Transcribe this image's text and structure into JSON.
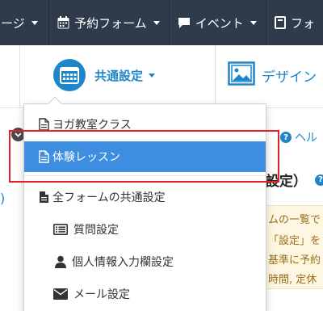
{
  "topnav": {
    "tab1_label": "ページ",
    "tab2_label": "予約フォーム",
    "tab3_label": "イベント",
    "tab4_label": "フォ"
  },
  "subnav": {
    "common_settings_label": "共通設定",
    "design_label": "デザイン"
  },
  "dropdown": {
    "items": [
      {
        "label": "ヨガ教室クラス",
        "icon": "document-icon"
      },
      {
        "label": "体験レッスン",
        "icon": "document-icon",
        "selected": true
      },
      {
        "label": "全フォームの共通設定",
        "icon": "document-filled-icon"
      },
      {
        "label": "質問設定",
        "icon": "list-icon"
      },
      {
        "label": "個人情報入力欄設定",
        "icon": "user-icon"
      },
      {
        "label": "メール設定",
        "icon": "envelope-icon"
      }
    ]
  },
  "content": {
    "help_text": "ヘル",
    "section_title": "設定）",
    "left_paren": ")",
    "notice_lines": [
      "ムの一覧で",
      "「設定」を",
      "基準に予約",
      "時間, 定休"
    ]
  },
  "colors": {
    "navbar_bg": "#2f3a4a",
    "accent": "#1f86c9",
    "selected_bg": "#3d8ee0",
    "annotation_red": "#e41f26"
  }
}
